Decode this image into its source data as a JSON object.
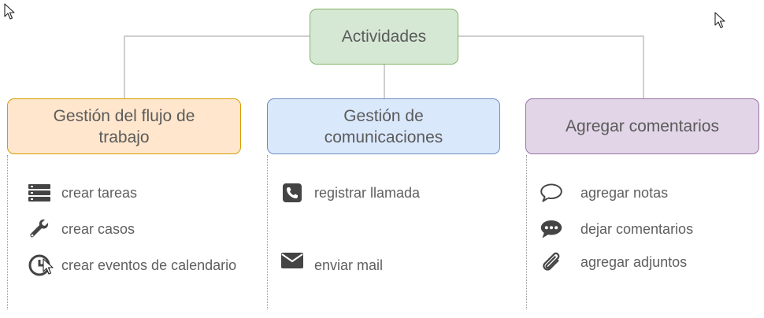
{
  "diagram": {
    "root": {
      "label": "Actividades"
    },
    "categories": [
      {
        "label": "Gestión del flujo de trabajo",
        "items": [
          {
            "label": "crear tareas",
            "icon": "server-icon"
          },
          {
            "label": "crear casos",
            "icon": "wrench-icon"
          },
          {
            "label": "crear eventos de calendario",
            "icon": "clock-icon"
          }
        ]
      },
      {
        "label": "Gestión de comunicaciones",
        "items": [
          {
            "label": "registrar llamada",
            "icon": "phone-icon"
          },
          {
            "label": "enviar mail",
            "icon": "envelope-icon"
          }
        ]
      },
      {
        "label": "Agregar comentarios",
        "items": [
          {
            "label": "agregar notas",
            "icon": "speech-bubble-outline-icon"
          },
          {
            "label": "dejar comentarios",
            "icon": "speech-bubble-dots-icon"
          },
          {
            "label": "agregar adjuntos",
            "icon": "paperclip-icon"
          }
        ]
      }
    ]
  },
  "colors": {
    "root_fill": "#d5e8d4",
    "root_border": "#82b366",
    "cat1_fill": "#ffe6cc",
    "cat1_border": "#d79b00",
    "cat2_fill": "#dae8fc",
    "cat2_border": "#6c8ebf",
    "cat3_fill": "#e1d5e7",
    "cat3_border": "#9673a6",
    "connector": "#cfcfcf",
    "icon": "#444444"
  }
}
